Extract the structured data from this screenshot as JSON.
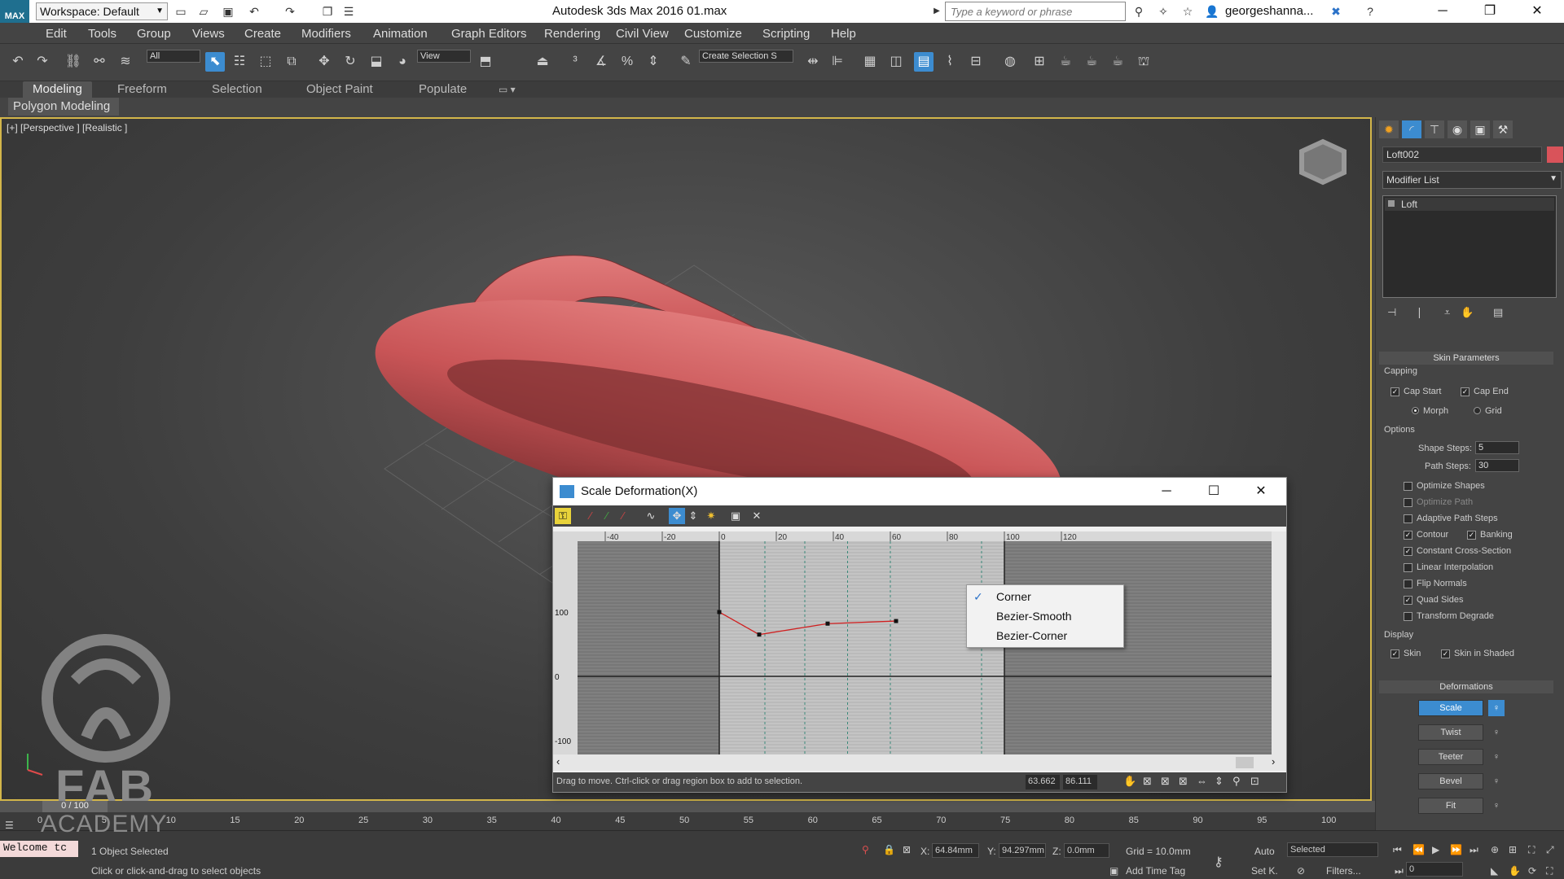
{
  "titlebar": {
    "logo_text": "MAX",
    "workspace": "Workspace: Default",
    "app_title": "Autodesk 3ds Max 2016     01.max",
    "search_placeholder": "Type a keyword or phrase",
    "user": "georgeshanna...",
    "minimize": "─",
    "maximize": "❐",
    "close": "✕"
  },
  "menubar": {
    "items": [
      "Edit",
      "Tools",
      "Group",
      "Views",
      "Create",
      "Modifiers",
      "Animation",
      "Graph Editors",
      "Rendering",
      "Civil View",
      "Customize",
      "Scripting",
      "Help"
    ]
  },
  "toolbar": {
    "filter_select": "All",
    "refcoord_select": "View",
    "selection_set": "Create Selection S"
  },
  "ribbon": {
    "tabs": [
      "Modeling",
      "Freeform",
      "Selection",
      "Object Paint",
      "Populate"
    ],
    "active_tab": "Modeling",
    "panel": "Polygon Modeling"
  },
  "viewport": {
    "label": "[+] [Perspective ] [Realistic ]",
    "watermark_top": "FAB",
    "watermark_bottom": "ACADEMY"
  },
  "command_panel": {
    "object_name": "Loft002",
    "object_color": "#d9535a",
    "modifier_list": "Modifier List",
    "stack_item": "Loft",
    "skin_params": {
      "title": "Skin Parameters",
      "capping": "Capping",
      "cap_start": "Cap Start",
      "cap_end": "Cap End",
      "morph": "Morph",
      "grid": "Grid",
      "options": "Options",
      "shape_steps_label": "Shape Steps:",
      "shape_steps": "5",
      "path_steps_label": "Path Steps:",
      "path_steps": "30",
      "optimize_shapes": "Optimize Shapes",
      "optimize_path": "Optimize Path",
      "adaptive_path_steps": "Adaptive Path Steps",
      "contour": "Contour",
      "banking": "Banking",
      "constant_cross_section": "Constant Cross-Section",
      "linear_interpolation": "Linear Interpolation",
      "flip_normals": "Flip Normals",
      "quad_sides": "Quad Sides",
      "transform_degrade": "Transform Degrade",
      "display": "Display",
      "skin": "Skin",
      "skin_in_shaded": "Skin in Shaded"
    },
    "deformations": {
      "title": "Deformations",
      "scale": "Scale",
      "twist": "Twist",
      "teeter": "Teeter",
      "bevel": "Bevel",
      "fit": "Fit"
    }
  },
  "dialog": {
    "title": "Scale Deformation(X)",
    "status": "Drag to move. Ctrl-click or drag region box to add to selection.",
    "coord_x": "63.662",
    "coord_y": "86.111",
    "ruler_labels": [
      "-40",
      "-20",
      "0",
      "20",
      "40",
      "60",
      "80",
      "100",
      "120"
    ],
    "y_labels": [
      "100",
      "0",
      "-100"
    ],
    "curve_points": [
      [
        0,
        100
      ],
      [
        14,
        65
      ],
      [
        38,
        82
      ],
      [
        62,
        86
      ]
    ]
  },
  "context_menu": {
    "items": [
      "Corner",
      "Bezier-Smooth",
      "Bezier-Corner"
    ],
    "checked": "Corner"
  },
  "timeline": {
    "frame": "0 / 100",
    "ticks": [
      "0",
      "5",
      "10",
      "15",
      "20",
      "25",
      "30",
      "35",
      "40",
      "45",
      "50",
      "55",
      "60",
      "65",
      "70",
      "75",
      "80",
      "85",
      "90",
      "95",
      "100"
    ]
  },
  "statusbar": {
    "script_listener": "Welcome tc",
    "selection_info": "1 Object Selected",
    "prompt": "Click or click-and-drag to select objects",
    "x_label": "X:",
    "x_value": "64.84mm",
    "y_label": "Y:",
    "y_value": "94.297mm",
    "z_label": "Z:",
    "z_value": "0.0mm",
    "grid": "Grid = 10.0mm",
    "add_time_tag": "Add Time Tag",
    "auto": "Auto",
    "set_key": "Set K.",
    "selected_dropdown": "Selected",
    "filters": "Filters...",
    "current_frame": "0"
  }
}
